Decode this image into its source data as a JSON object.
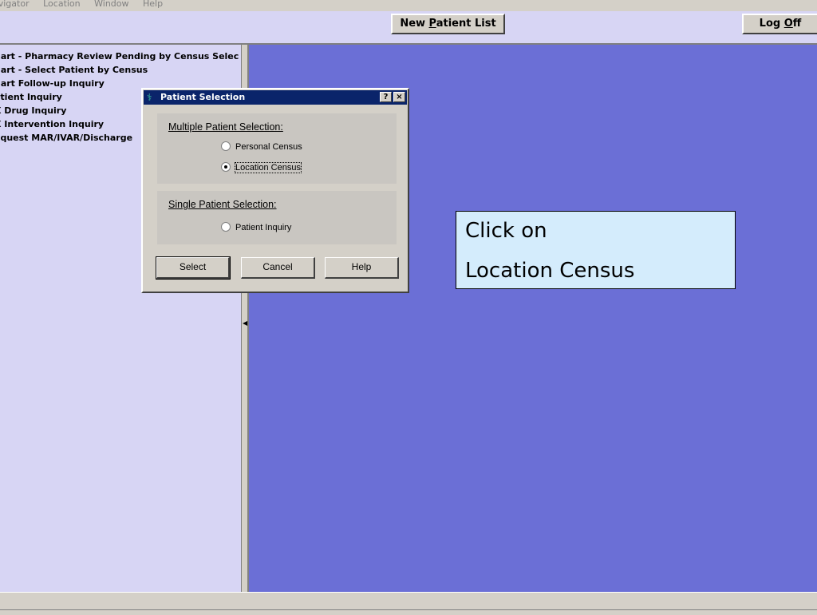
{
  "menubar": {
    "items": [
      "avigator",
      "Location",
      "Window",
      "Help"
    ]
  },
  "toolbar": {
    "new_patient_list": {
      "pre": "New ",
      "accel": "P",
      "post": "atient List"
    },
    "log_off": {
      "pre": "Log ",
      "accel": "O",
      "post": "ff"
    }
  },
  "navigator": {
    "items": [
      "hart - Pharmacy Review Pending by Census Selec",
      "hart - Select Patient by Census",
      "hart Follow-up Inquiry",
      "atient Inquiry",
      "X Drug Inquiry",
      "X Intervention Inquiry",
      "equest MAR/IVAR/Discharge"
    ]
  },
  "dialog": {
    "title": "Patient Selection",
    "help_btn": "?",
    "close_btn": "×",
    "multiple_group_title": "Multiple Patient Selection:",
    "multiple_options": [
      {
        "label": "Personal Census",
        "checked": false
      },
      {
        "label": "Location Census",
        "checked": true
      }
    ],
    "single_group_title": "Single Patient Selection:",
    "single_options": [
      {
        "label": "Patient Inquiry",
        "checked": false
      }
    ],
    "buttons": {
      "select": "Select",
      "cancel": "Cancel",
      "help": "Help"
    }
  },
  "callout": {
    "line1": "Click on",
    "line2": "Location Census"
  },
  "colors": {
    "toolbar_bg": "#d7d5f4",
    "workspace_bg": "#6b6fd6",
    "titlebar_bg": "#0a246a",
    "callout_bg": "#d4ecfc"
  }
}
